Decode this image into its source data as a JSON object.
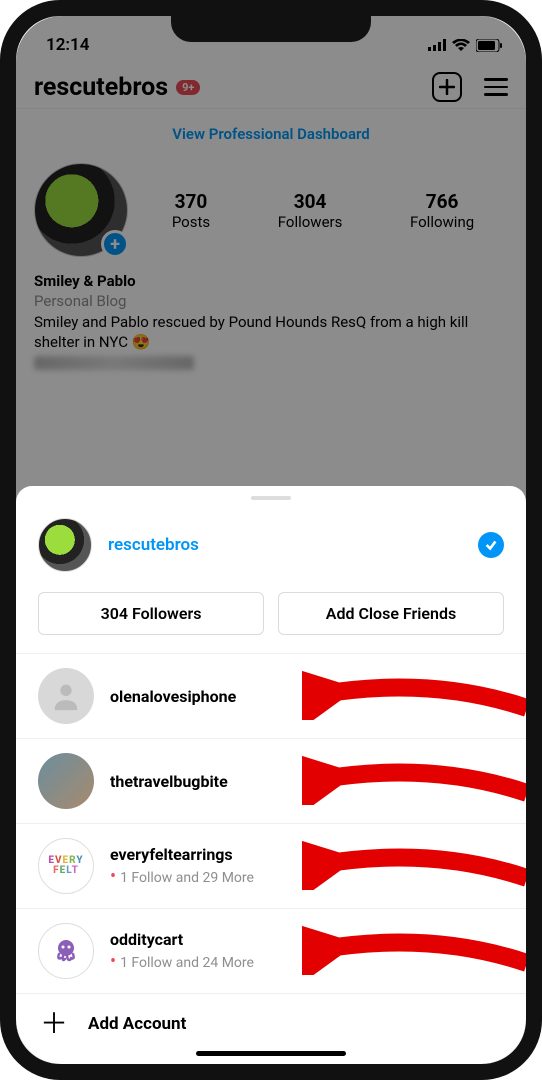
{
  "status_bar": {
    "time": "12:14"
  },
  "header": {
    "username": "rescutebros",
    "badge": "9+"
  },
  "dashboard_link": "View Professional Dashboard",
  "stats": {
    "posts": {
      "count": "370",
      "label": "Posts"
    },
    "followers": {
      "count": "304",
      "label": "Followers"
    },
    "following": {
      "count": "766",
      "label": "Following"
    }
  },
  "bio": {
    "display_name": "Smiley & Pablo",
    "category": "Personal Blog",
    "text": "Smiley and Pablo rescued by Pound Hounds ResQ from a high kill shelter in NYC 😍"
  },
  "sheet": {
    "current": {
      "username": "rescutebros"
    },
    "buttons": {
      "followers": "304 Followers",
      "close_friends": "Add Close Friends"
    },
    "accounts": [
      {
        "username": "olenalovesiphone",
        "subtitle": "",
        "avatar": "blank"
      },
      {
        "username": "thetravelbugbite",
        "subtitle": "",
        "avatar": "travel"
      },
      {
        "username": "everyfeltearrings",
        "subtitle": "1 Follow and 29 More",
        "avatar": "every"
      },
      {
        "username": "odditycart",
        "subtitle": "1 Follow and 24 More",
        "avatar": "oddity"
      }
    ],
    "add_account": "Add Account"
  }
}
